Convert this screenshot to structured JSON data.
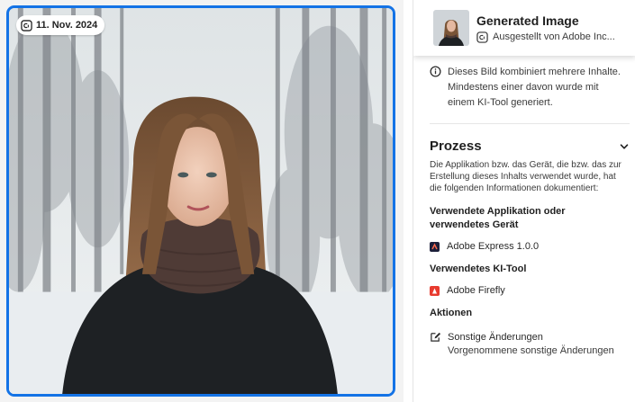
{
  "image_panel": {
    "date_label": "11. Nov. 2024",
    "photo_icon": "content-credentials-icon"
  },
  "header": {
    "title": "Generated Image",
    "subtitle": "Ausgestellt von Adobe Inc...",
    "badge_icon": "content-credentials-icon"
  },
  "notice": {
    "icon": "info-icon",
    "text": "Dieses Bild kombiniert mehrere Inhalte. Mindestens einer davon wurde mit einem KI-Tool generiert."
  },
  "process": {
    "title": "Prozess",
    "toggle_icon": "chevron-down-icon",
    "description": "Die Applikation bzw. das Gerät, die bzw. das zur Erstellung dieses Inhalts verwendet wurde, hat die folgenden Informationen dokumentiert:",
    "app_heading": "Verwendete Applikation oder verwendetes Gerät",
    "app_name": "Adobe Express 1.0.0",
    "ai_heading": "Verwendetes KI-Tool",
    "ai_name": "Adobe Firefly",
    "actions_heading": "Aktionen",
    "action_label": "Sonstige Änderungen",
    "action_desc": "Vorgenommene sonstige Änderungen"
  },
  "colors": {
    "accent": "#1473e6",
    "express_icon": "#1c1f3a",
    "firefly_icon": "#e83b2f"
  }
}
